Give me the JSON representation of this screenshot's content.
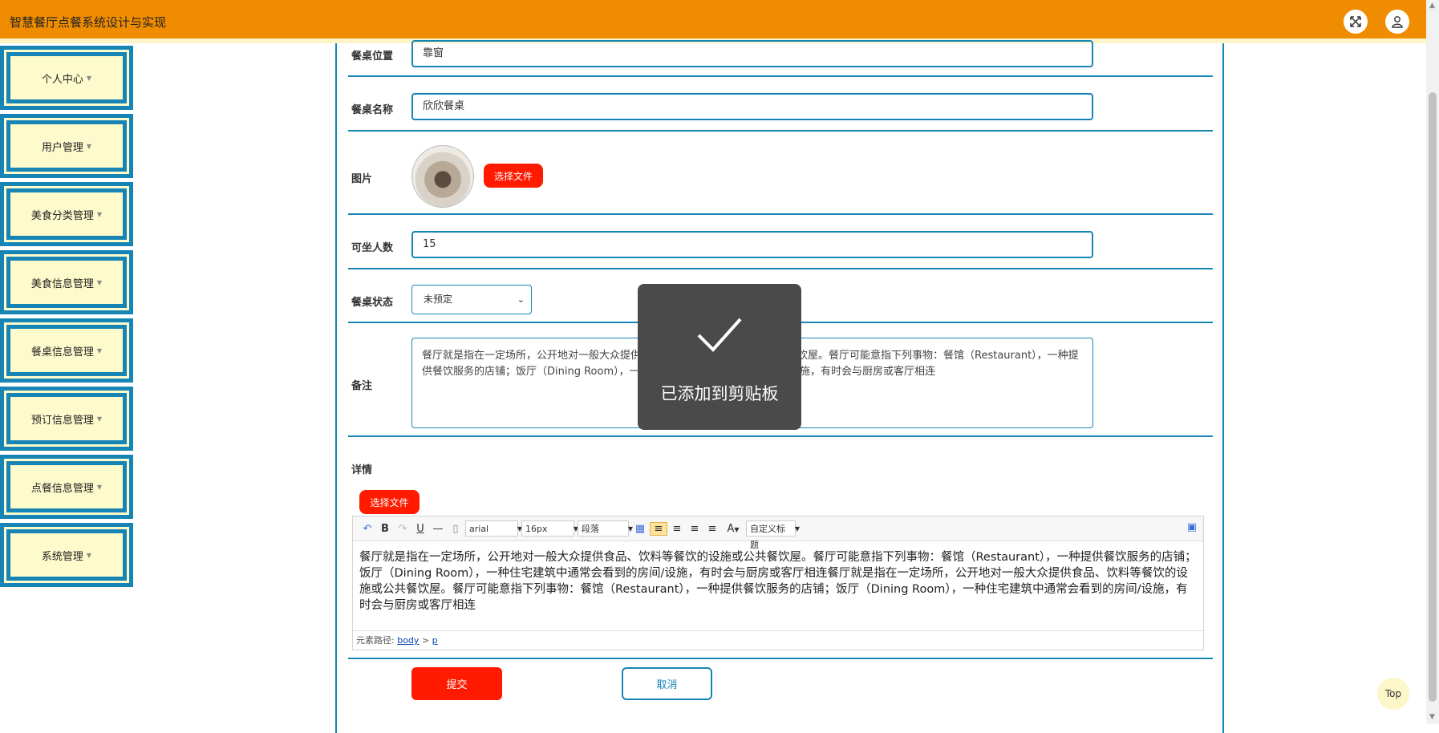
{
  "header": {
    "title": "智慧餐厅点餐系统设计与实现"
  },
  "sidebar": {
    "items": [
      {
        "label": "个人中心"
      },
      {
        "label": "用户管理"
      },
      {
        "label": "美食分类管理"
      },
      {
        "label": "美食信息管理"
      },
      {
        "label": "餐桌信息管理"
      },
      {
        "label": "预订信息管理"
      },
      {
        "label": "点餐信息管理"
      },
      {
        "label": "系统管理"
      }
    ],
    "caret": "▼"
  },
  "form": {
    "location_label": "餐桌位置",
    "location_value": "靠窗",
    "name_label": "餐桌名称",
    "name_value": "欣欣餐桌",
    "image_label": "图片",
    "file_button": "选择文件",
    "seats_label": "可坐人数",
    "seats_value": "15",
    "status_label": "餐桌状态",
    "status_value": "未预定",
    "note_label": "备注",
    "note_value": "餐厅就是指在一定场所，公开地对一般大众提供食品、饮料等餐饮的设施或公共餐饮屋。餐厅可能意指下列事物：餐馆（Restaurant），一种提供餐饮服务的店铺；饭厅（Dining Room），一种住宅建筑中通常会看到的房间/设施，有时会与厨房或客厅相连",
    "detail_label": "详情",
    "detail_file_button": "选择文件",
    "submit": "提交",
    "cancel": "取消"
  },
  "editor": {
    "font": "arial",
    "size": "16px",
    "paragraph": "段落",
    "custom_title": "自定义标题",
    "content": "餐厅就是指在一定场所，公开地对一般大众提供食品、饮料等餐饮的设施或公共餐饮屋。餐厅可能意指下列事物：餐馆（Restaurant），一种提供餐饮服务的店铺；饭厅（Dining Room），一种住宅建筑中通常会看到的房间/设施，有时会与厨房或客厅相连餐厅就是指在一定场所，公开地对一般大众提供食品、饮料等餐饮的设施或公共餐饮屋。餐厅可能意指下列事物：餐馆（Restaurant），一种提供餐饮服务的店铺；饭厅（Dining Room），一种住宅建筑中通常会看到的房间/设施，有时会与厨房或客厅相连",
    "path_label": "元素路径:",
    "path_body": "body",
    "path_sep": ">",
    "path_p": "p"
  },
  "toast": {
    "message": "已添加到剪贴板"
  },
  "top_button": "Top"
}
